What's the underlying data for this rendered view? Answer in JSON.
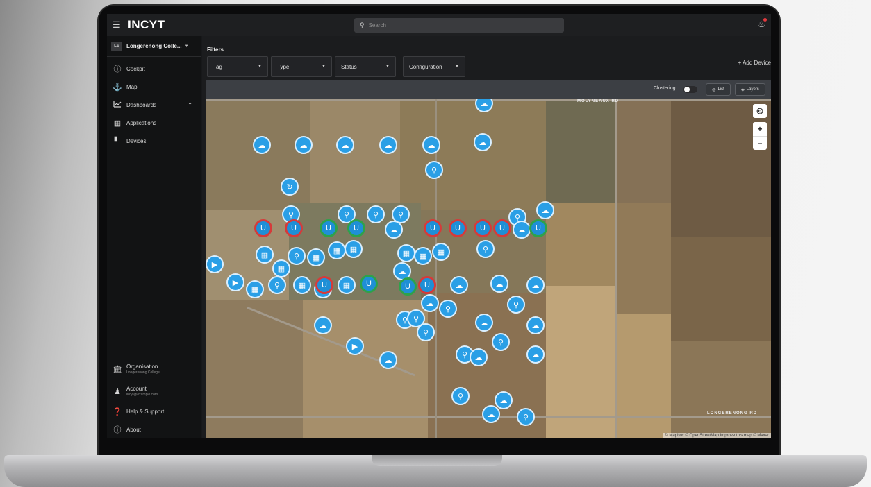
{
  "app": {
    "brand": "INCYT",
    "search_placeholder": "Search"
  },
  "sidebar": {
    "org_badge": "LE",
    "org_name": "Longerenong Colle...",
    "items": [
      {
        "label": "Cockpit",
        "icon": "gauge-icon"
      },
      {
        "label": "Map",
        "icon": "anchor-icon"
      },
      {
        "label": "Dashboards",
        "icon": "chart-line-icon"
      },
      {
        "label": "Applications",
        "icon": "applications-icon"
      },
      {
        "label": "Devices",
        "icon": "devices-icon"
      }
    ],
    "bottom": {
      "organisation_label": "Organisation",
      "organisation_sub": "Longerenong College",
      "account_label": "Account",
      "account_sub": "incyt@example.com",
      "help_label": "Help & Support",
      "about_label": "About"
    }
  },
  "filters": {
    "title": "Filters",
    "tag": "Tag",
    "type": "Type",
    "status": "Status",
    "configuration": "Configuration",
    "add_device": "+ Add Device"
  },
  "map_toolbar": {
    "clustering_label": "Clustering",
    "clustering_on": false,
    "list_label": "List",
    "layers_label": "Layers"
  },
  "map": {
    "road_labels": [
      "MOLYNEAUX RD",
      "LONGERENONG RD"
    ],
    "attribution": "© Mapbox © OpenStreetMap  Improve this map  © Maxar",
    "zoom_in": "+",
    "zoom_out": "−"
  },
  "colors": {
    "marker_blue": "#2a9fe6",
    "alert_red": "#d63a3a",
    "ok_green": "#2da24b"
  }
}
